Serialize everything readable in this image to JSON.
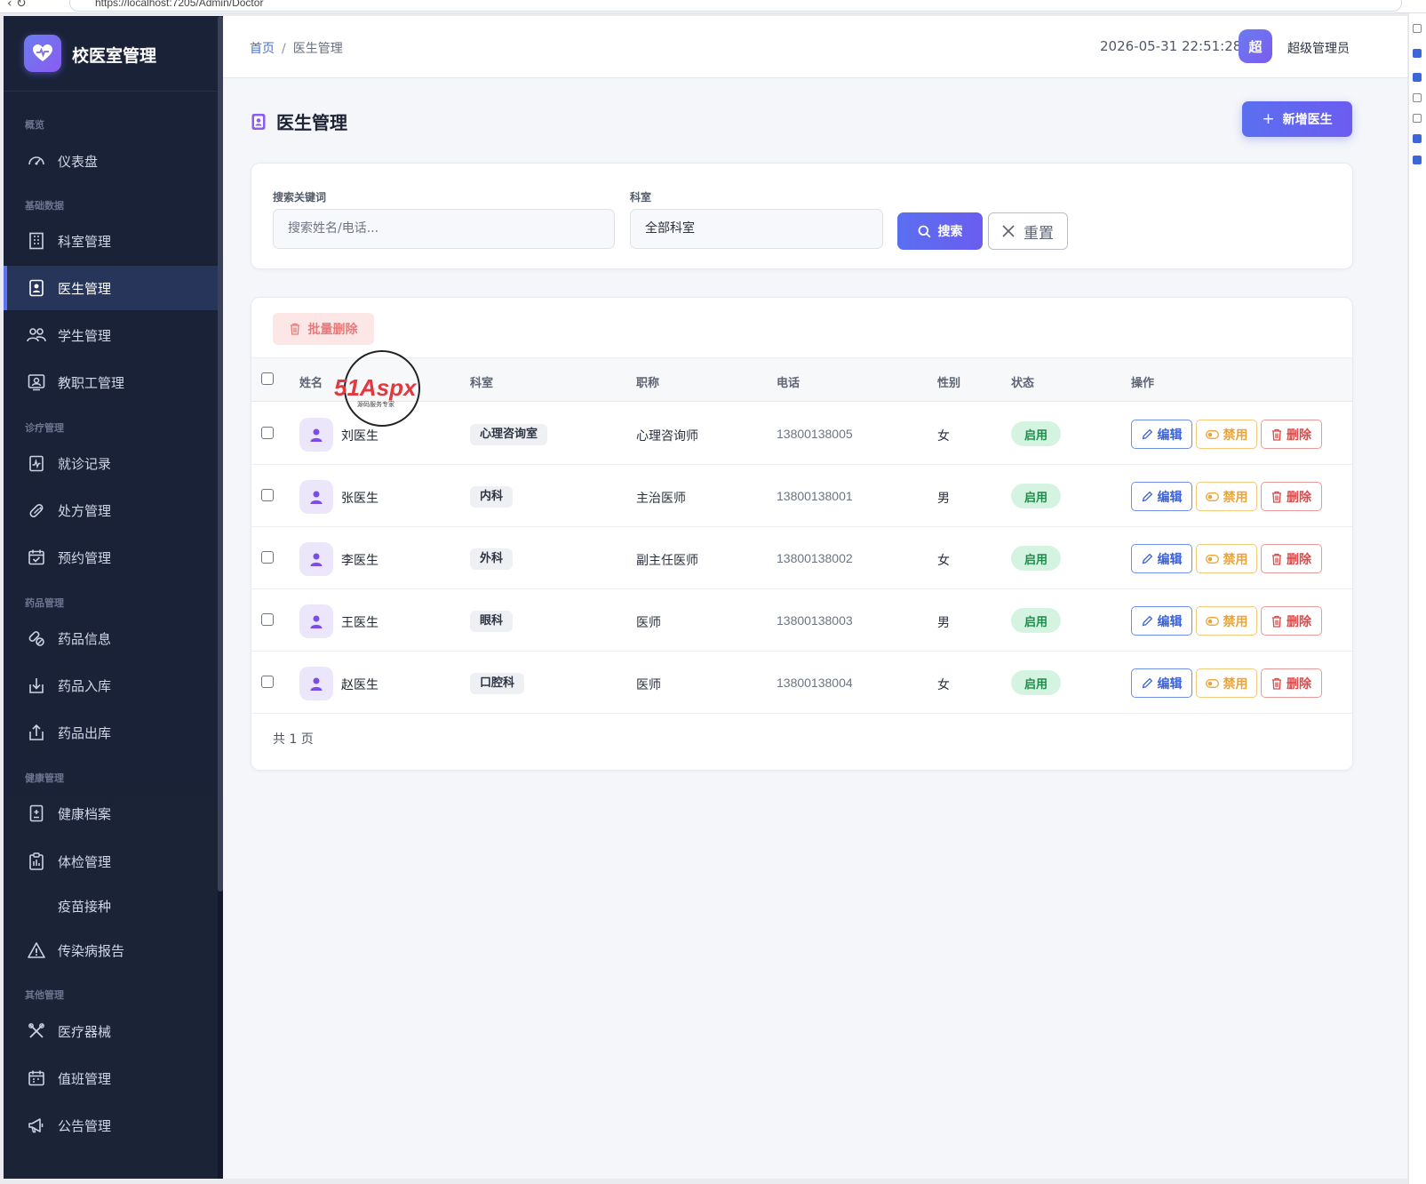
{
  "browser": {
    "url": "https://localhost:7205/Admin/Doctor"
  },
  "app": {
    "name": "校医室管理"
  },
  "sidebar": {
    "sections": [
      {
        "title": "概览",
        "items": [
          {
            "label": "仪表盘",
            "icon": "dashboard-gauge-icon"
          }
        ]
      },
      {
        "title": "基础数据",
        "items": [
          {
            "label": "科室管理",
            "icon": "building-icon"
          },
          {
            "label": "医生管理",
            "icon": "id-badge-icon",
            "active": true
          },
          {
            "label": "学生管理",
            "icon": "people-icon"
          },
          {
            "label": "教职工管理",
            "icon": "person-card-icon"
          }
        ]
      },
      {
        "title": "诊疗管理",
        "items": [
          {
            "label": "就诊记录",
            "icon": "clipboard-pulse-icon"
          },
          {
            "label": "处方管理",
            "icon": "pill-icon"
          },
          {
            "label": "预约管理",
            "icon": "calendar-check-icon"
          }
        ]
      },
      {
        "title": "药品管理",
        "items": [
          {
            "label": "药品信息",
            "icon": "capsule-icon"
          },
          {
            "label": "药品入库",
            "icon": "box-arrow-in-icon"
          },
          {
            "label": "药品出库",
            "icon": "box-arrow-out-icon"
          }
        ]
      },
      {
        "title": "健康管理",
        "items": [
          {
            "label": "健康档案",
            "icon": "file-medical-icon"
          },
          {
            "label": "体检管理",
            "icon": "clipboard-list-icon"
          },
          {
            "label": "疫苗接种",
            "icon": ""
          },
          {
            "label": "传染病报告",
            "icon": "warning-triangle-icon"
          }
        ]
      },
      {
        "title": "其他管理",
        "items": [
          {
            "label": "医疗器械",
            "icon": "tools-icon"
          },
          {
            "label": "值班管理",
            "icon": "calendar-icon"
          },
          {
            "label": "公告管理",
            "icon": "megaphone-icon"
          }
        ]
      }
    ]
  },
  "topbar": {
    "breadcrumb": {
      "home": "首页",
      "separator": "/",
      "current": "医生管理"
    },
    "datetime": "2026-05-31 22:51:28",
    "avatar_text": "超",
    "user_name": "超级管理员"
  },
  "page": {
    "title": "医生管理",
    "add_button": "新增医生"
  },
  "filters": {
    "keyword_label": "搜索关键词",
    "keyword_placeholder": "搜索姓名/电话...",
    "dept_label": "科室",
    "dept_value": "全部科室",
    "search_button": "搜索",
    "reset_button": "重置"
  },
  "table": {
    "batch_delete": "批量删除",
    "columns": [
      "姓名",
      "科室",
      "职称",
      "电话",
      "性别",
      "状态",
      "操作"
    ],
    "rows": [
      {
        "name": "刘医生",
        "dept": "心理咨询室",
        "title": "心理咨询师",
        "phone": "13800138005",
        "gender": "女",
        "status": "启用"
      },
      {
        "name": "张医生",
        "dept": "内科",
        "title": "主治医师",
        "phone": "13800138001",
        "gender": "男",
        "status": "启用"
      },
      {
        "name": "李医生",
        "dept": "外科",
        "title": "副主任医师",
        "phone": "13800138002",
        "gender": "女",
        "status": "启用"
      },
      {
        "name": "王医生",
        "dept": "眼科",
        "title": "医师",
        "phone": "13800138003",
        "gender": "男",
        "status": "启用"
      },
      {
        "name": "赵医生",
        "dept": "口腔科",
        "title": "医师",
        "phone": "13800138004",
        "gender": "女",
        "status": "启用"
      }
    ],
    "actions": {
      "edit": "编辑",
      "disable": "禁用",
      "delete": "删除"
    },
    "pager": "共 1 页"
  },
  "watermark": {
    "brand": "51Aspx",
    "tagline": "源码服务专家"
  },
  "colors": {
    "sidebar_bg": "#1a2238",
    "accent": "#5b6ff0",
    "status_green": "#1f8a4a",
    "danger": "#db4b4b",
    "warning": "#e9a43a"
  }
}
